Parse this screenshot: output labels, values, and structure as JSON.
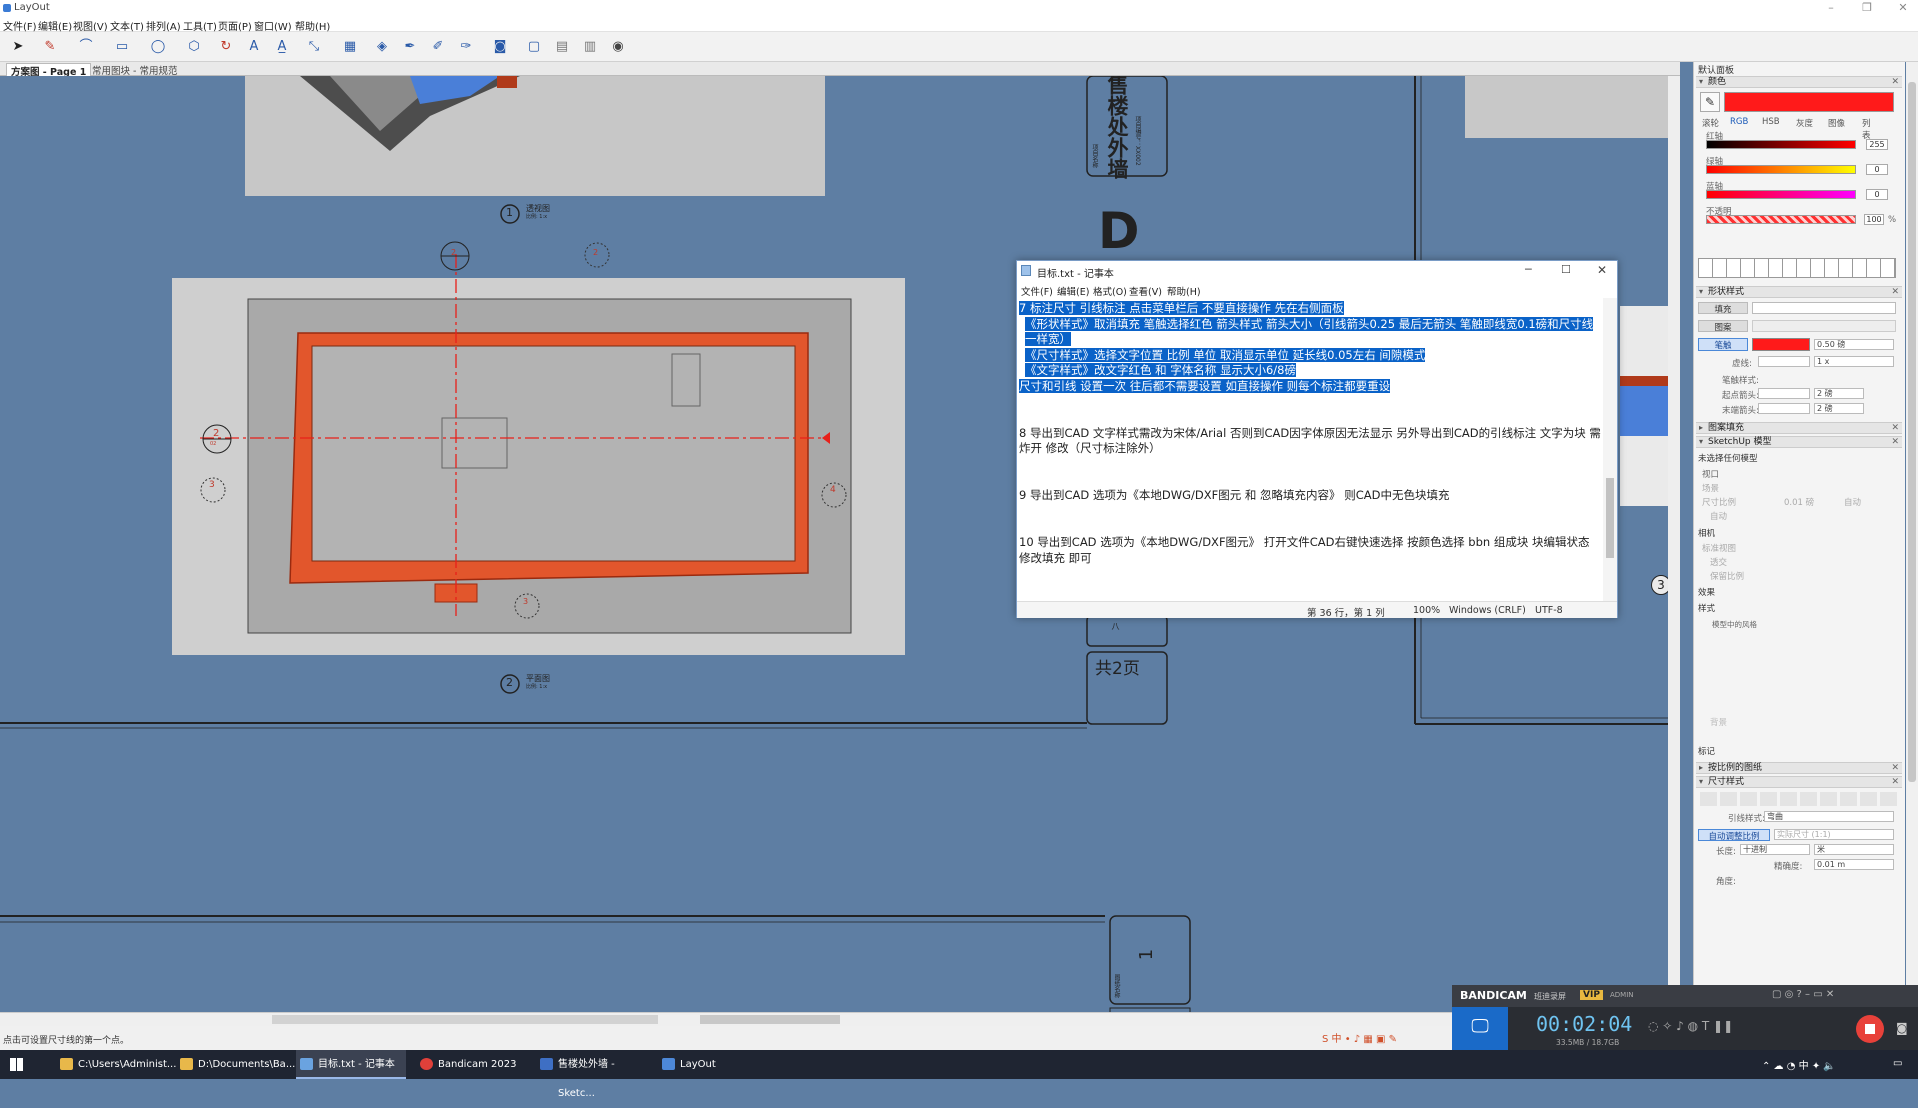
{
  "app": {
    "title": "LayOut"
  },
  "menu": [
    "文件(F)",
    "编辑(E)",
    "视图(V)",
    "文本(T)",
    "排列(A)",
    "工具(T)",
    "页面(P)",
    "窗口(W)",
    "帮助(H)"
  ],
  "tabs": [
    "方案图 - Page 1",
    "常用图块 - 常用规范"
  ],
  "drawing": {
    "view1_num": "1",
    "view1_title": "透视图",
    "view2_num": "2",
    "view2_title": "平面图",
    "view3_num": "3",
    "project_name": "售楼处外墙",
    "title_label1": "项目名称",
    "title_label2": "项目编号：XX002",
    "big_letter": "D",
    "pages": "共2页",
    "page_num": "1",
    "eight_char": "八",
    "marker2": "2",
    "marker3": "3",
    "marker4": "4",
    "marker2b": "2",
    "marker_sub": "02",
    "small_label": "比例: 1:x",
    "side_label": "图纸名称"
  },
  "notepad": {
    "title": "目标.txt - 记事本",
    "menu": [
      "文件(F)",
      "编辑(E)",
      "格式(O)",
      "查看(V)",
      "帮助(H)"
    ],
    "lines": [
      {
        "t": "7 标注尺寸 引线标注 点击菜单栏后 不要直接操作 先在右侧面板",
        "hl": true
      },
      {
        "t": "《形状样式》取消填充 笔触选择红色 箭头样式 箭头大小（引线箭头0.25 最后无箭头 笔触即线宽0.1磅和尺寸线一样宽）",
        "hl": true
      },
      {
        "t": "《尺寸样式》选择文字位置 比例 单位 取消显示单位 延长线0.05左右 间隙模式",
        "hl": true
      },
      {
        "t": "《文字样式》改文字红色 和 字体名称 显示大小6/8磅",
        "hl": true
      },
      {
        "t": "尺寸和引线 设置一次 往后都不需要设置 如直接操作 则每个标注都要重设",
        "hl": true
      },
      {
        "t": "",
        "hl": false
      },
      {
        "t": "",
        "hl": false
      },
      {
        "t": "8 导出到CAD 文字样式需改为宋体/Arial 否则到CAD因字体原因无法显示 另外导出到CAD的引线标注 文字为块 需炸开 修改（尺寸标注除外）",
        "hl": false
      },
      {
        "t": "",
        "hl": false
      },
      {
        "t": "",
        "hl": false
      },
      {
        "t": "9 导出到CAD 选项为《本地DWG/DXF图元 和 忽略填充内容》 则CAD中无色块填充",
        "hl": false
      },
      {
        "t": "",
        "hl": false
      },
      {
        "t": "",
        "hl": false
      },
      {
        "t": "10 导出到CAD 选项为《本地DWG/DXF图元》 打开文件CAD右键快速选择 按颜色选择 bbn 组成块 块编辑状态 修改填充 即可",
        "hl": false
      }
    ],
    "status": {
      "pos": "第 36 行，第 1 列",
      "zoom": "100%",
      "eol": "Windows (CRLF)",
      "enc": "UTF-8"
    }
  },
  "panel": {
    "title": "默认面板",
    "color": {
      "section": "颜色",
      "tabs": [
        "滚轮",
        "RGB",
        "HSB",
        "灰度",
        "图像",
        "列表"
      ],
      "red_label": "红轴",
      "green_label": "绿轴",
      "blue_label": "蓝轴",
      "opacity_label": "不透明",
      "red": "255",
      "green": "0",
      "blue": "0",
      "opacity": "100",
      "pct": "%",
      "swatch": "#ff1a1a"
    },
    "shape": {
      "section": "形状样式",
      "fill": "填充",
      "pattern": "图案",
      "stroke": "笔触",
      "stroke_w": "0.50 磅",
      "dash": "虚线:",
      "dash_v": "1 x",
      "pen": "笔触样式:",
      "start": "起点箭头:",
      "start_v": "2 磅",
      "end": "末端箭头:",
      "end_v": "2 磅"
    },
    "pattern_fill": {
      "section": "图案填充"
    },
    "sketchup": {
      "section": "SketchUp 模型",
      "no_model": "未选择任何模型",
      "view": "视口",
      "scene": "场景",
      "scale": "尺寸比例",
      "scale_v": "0.01 磅",
      "auto": "自动",
      "auto2": "自动",
      "camera": "相机",
      "std": "标准视图",
      "persp": "透交",
      "keep": "保留比例",
      "effect": "效果",
      "style": "样式",
      "style_v": "模型中的风格",
      "bg": "背景",
      "tag": "标记"
    },
    "scaled": {
      "section": "按比例的图纸"
    },
    "dim": {
      "section": "尺寸样式",
      "leader": "引线样式:",
      "leader_v": "弯曲",
      "auto_scale": "自动调整比例",
      "actual": "实际尺寸 (1:1)",
      "length": "长度:",
      "length_unit": "十进制",
      "length_u2": "米",
      "precision": "精确度:",
      "precision_v": "0.01 m",
      "angle": "角度:"
    }
  },
  "statusbar": {
    "hint": "点击可设置尺寸线的第一个点。"
  },
  "taskbar": [
    {
      "label": "C:\\Users\\Administ...",
      "color": "#e8b84a"
    },
    {
      "label": "D:\\Documents\\Ba...",
      "color": "#e8b84a"
    },
    {
      "label": "目标.txt - 记事本",
      "color": "#6aa3e0",
      "active": true
    },
    {
      "label": "Bandicam 2023",
      "color": "#e0403a"
    },
    {
      "label": "售楼处外墙 - Sketc...",
      "color": "#3e6fc4"
    },
    {
      "label": "LayOut",
      "color": "#4d88d8"
    }
  ],
  "bandicam": {
    "brand": "BANDICAM",
    "sub": "班迪录屏",
    "vip": "VIP",
    "admin": "ADMIN",
    "time": "00:02:04",
    "size": "33.5MB / 18.7GB"
  }
}
